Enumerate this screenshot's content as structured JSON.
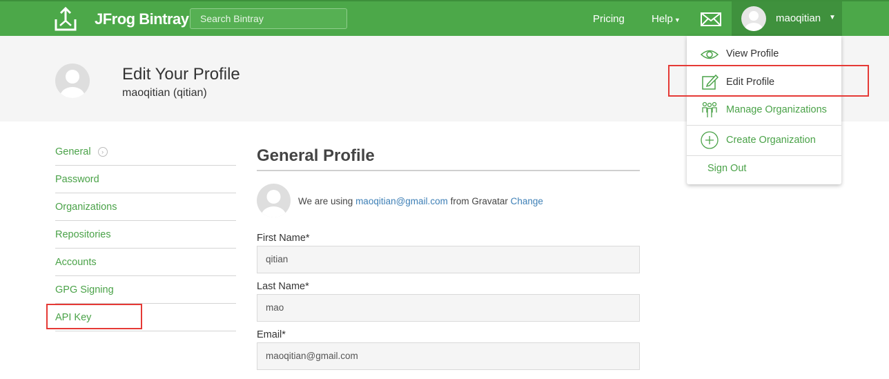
{
  "topbar": {
    "brand": "JFrog Bintray",
    "search_placeholder": "Search Bintray",
    "nav_pricing": "Pricing",
    "nav_help": "Help",
    "username": "maoqitian",
    "mail_icon": "envelope-icon",
    "accent": "#4ca849"
  },
  "header": {
    "title": "Edit Your Profile",
    "subtitle": "maoqitian (qitian)"
  },
  "sidebar": {
    "items": [
      {
        "label": "General"
      },
      {
        "label": "Password"
      },
      {
        "label": "Organizations"
      },
      {
        "label": "Repositories"
      },
      {
        "label": "Accounts"
      },
      {
        "label": "GPG Signing"
      },
      {
        "label": "API Key"
      }
    ]
  },
  "profile": {
    "section_title": "General Profile",
    "gravatar_prefix": "We are using",
    "gravatar_email": "maoqitian@gmail.com",
    "gravatar_middle": "from Gravatar",
    "gravatar_change": "Change",
    "first_name_label": "First Name*",
    "first_name_value": "qitian",
    "last_name_label": "Last Name*",
    "last_name_value": "mao",
    "email_label": "Email*",
    "email_value": "maoqitian@gmail.com"
  },
  "user_menu": {
    "view_profile": "View Profile",
    "edit_profile": "Edit Profile",
    "manage_orgs": "Manage Organizations",
    "create_org": "Create Organization",
    "sign_out": "Sign Out"
  },
  "highlight_color": "#e53935"
}
